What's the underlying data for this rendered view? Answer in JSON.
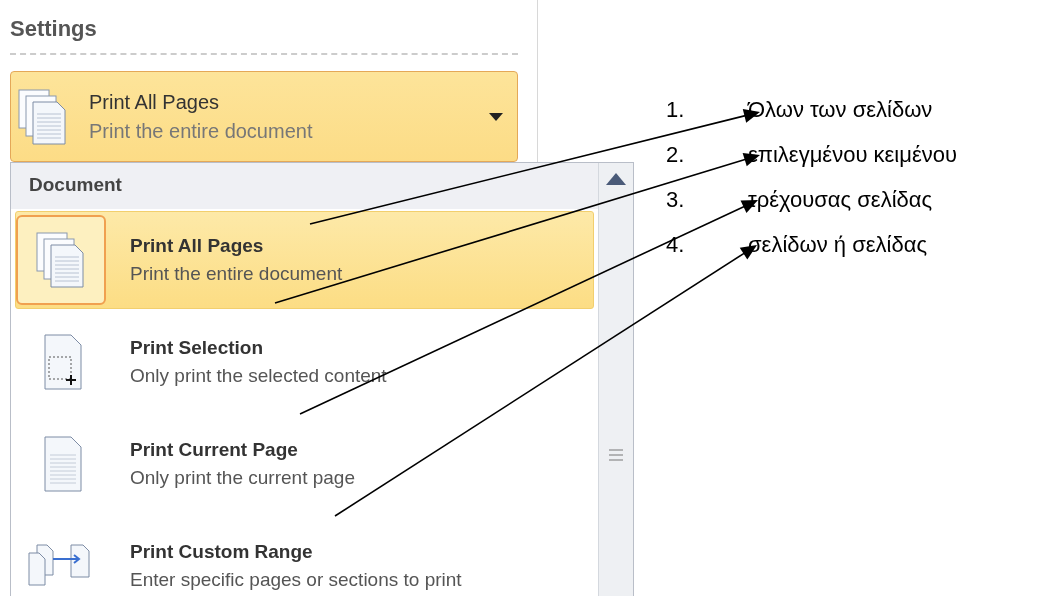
{
  "settings": {
    "title": "Settings",
    "dropdown": {
      "label": "Print All Pages",
      "description": "Print the entire document",
      "kind": "pages"
    }
  },
  "menu": {
    "section": "Document",
    "items": [
      {
        "label": "Print All Pages",
        "description": "Print the entire document",
        "kind": "pages",
        "selected": true
      },
      {
        "label": "Print Selection",
        "description": "Only print the selected content",
        "kind": "selection",
        "selected": false
      },
      {
        "label": "Print Current Page",
        "description": "Only print the current page",
        "kind": "page",
        "selected": false
      },
      {
        "label": "Print Custom Range",
        "description": "Enter specific pages or sections to print",
        "kind": "range",
        "selected": false
      }
    ]
  },
  "annotations": [
    {
      "number": "1.",
      "text": "Όλων των σελίδων"
    },
    {
      "number": "2.",
      "text": "επιλεγμένου κειμένου"
    },
    {
      "number": "3.",
      "text": "τρέχουσας σελίδας"
    },
    {
      "number": "4.",
      "text": "σελίδων ή σελίδας"
    }
  ]
}
